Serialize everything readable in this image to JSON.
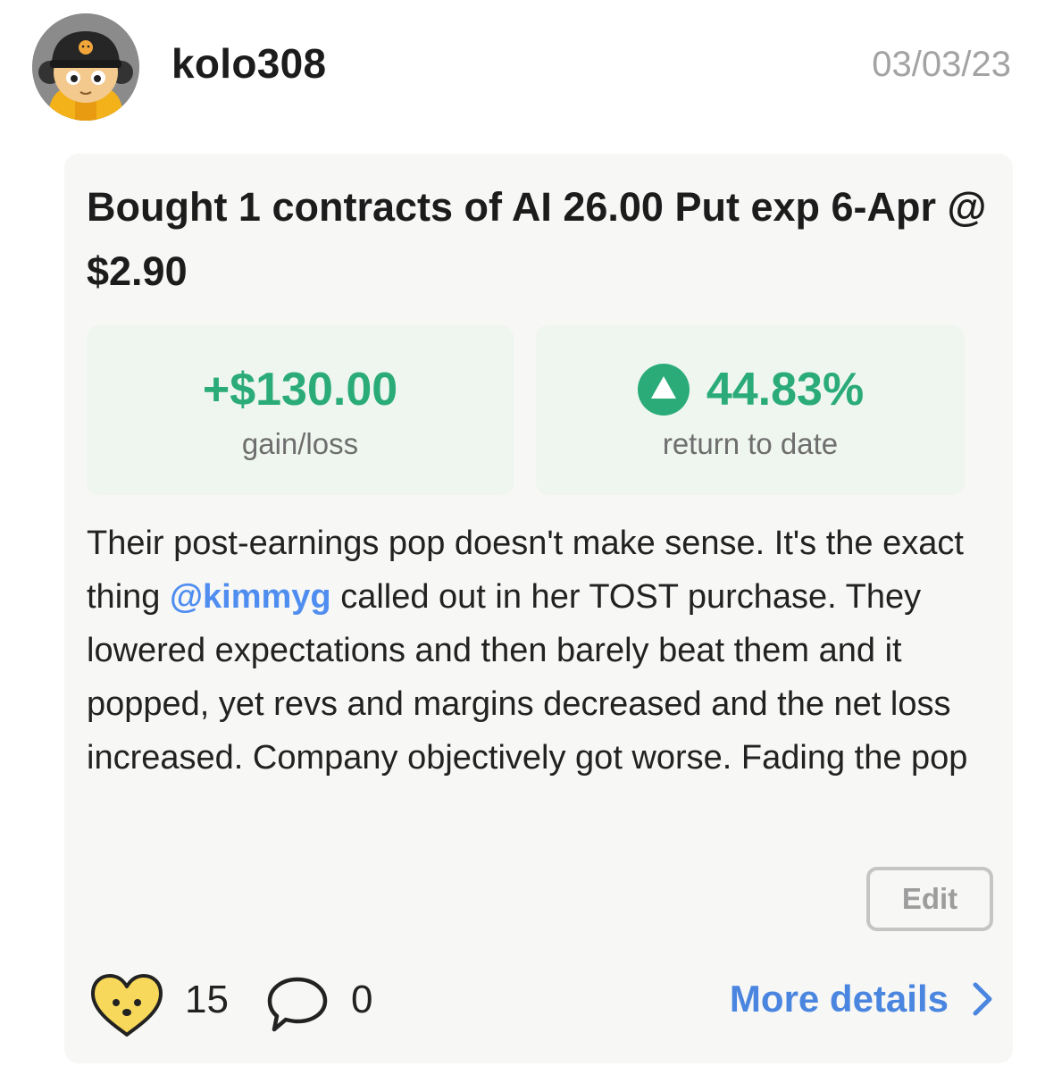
{
  "user": {
    "username": "kolo308",
    "date": "03/03/23"
  },
  "trade": {
    "title": "Bought 1 contracts of AI 26.00 Put exp 6-Apr @ $2.90"
  },
  "stats": {
    "gain_value": "+$130.00",
    "gain_label": "gain/loss",
    "return_value": "44.83%",
    "return_label": "return to date"
  },
  "post": {
    "text_before_mention": "Their post-earnings pop doesn't make sense. It's the exact thing ",
    "mention": "@kimmyg",
    "text_after_mention": " called out in her TOST purchase. They lowered expectations and then barely beat them and it popped, yet revs and margins decreased and the net loss increased. Company objectively got worse. Fading the pop"
  },
  "actions": {
    "edit_label": "Edit",
    "like_count": "15",
    "comment_count": "0",
    "more_details_label": "More details"
  },
  "icons": {
    "like": "heart-face-icon",
    "comment": "speech-bubble-icon",
    "return_trend": "up-triangle-icon",
    "more": "chevron-right-icon"
  },
  "colors": {
    "gain": "#2aab78",
    "mention": "#4f8ef0",
    "link": "#4a86e0",
    "card_bg": "#f7f7f5",
    "stat_bg": "#eef6ef"
  }
}
